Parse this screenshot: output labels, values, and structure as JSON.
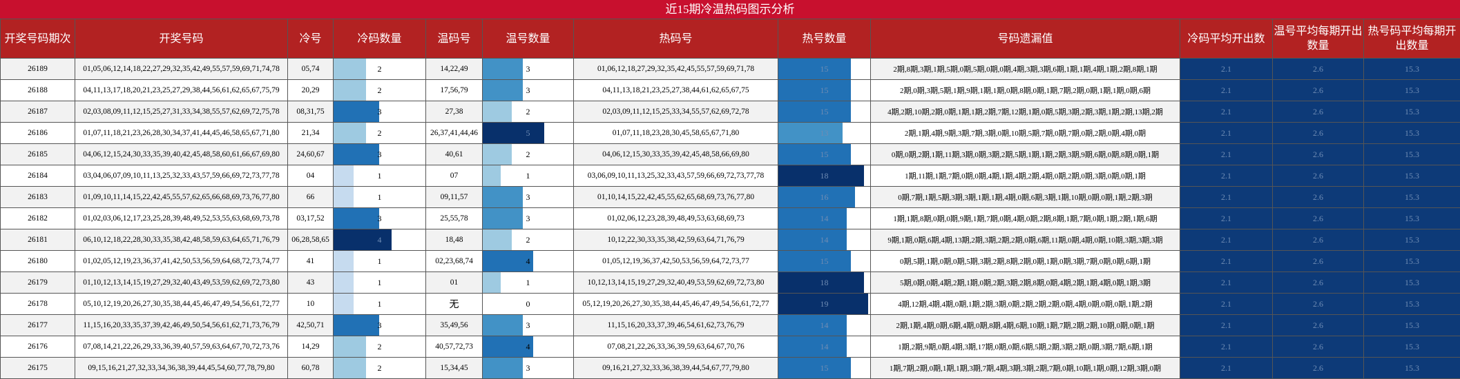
{
  "title": "近15期冷温热码图示分析",
  "headers": [
    "开奖号码期次",
    "开奖号码",
    "冷号",
    "冷码数量",
    "温码号",
    "温号数量",
    "热码号",
    "热号数量",
    "号码遗漏值",
    "冷码平均开出数",
    "温号平均每期开出数量",
    "热号码平均每期开出数量"
  ],
  "chart_data": {
    "type": "table",
    "title": "近15期冷温热码图示分析",
    "bar_max": {
      "cold": 4,
      "warm": 5,
      "hot": 19
    },
    "colors": {
      "header": "#b22222",
      "title": "#c8102e",
      "summary": "#0d3a78",
      "bar_light": "#c6dbef",
      "bar_mid": "#9ecae1",
      "bar_blue": "#4292c6",
      "bar_deep": "#2171b5",
      "bar_dark": "#08306b"
    },
    "rows": [
      {
        "issue": "26189",
        "numbers": "01,05,06,12,14,18,22,27,29,32,35,42,49,55,57,59,69,71,74,78",
        "cold": "05,74",
        "cold_count": 2,
        "warm": "14,22,49",
        "warm_count": 3,
        "hot": "01,06,12,18,27,29,32,35,42,45,55,57,59,69,71,78",
        "hot_count": 15,
        "miss": "2期,8期,3期,1期,5期,0期,5期,0期,0期,4期,3期,3期,6期,1期,1期,4期,1期,2期,8期,1期",
        "cold_avg": "2.1",
        "warm_avg": "2.6",
        "hot_avg": "15.3"
      },
      {
        "issue": "26188",
        "numbers": "04,11,13,17,18,20,21,23,25,27,29,38,44,56,61,62,65,67,75,79",
        "cold": "20,29",
        "cold_count": 2,
        "warm": "17,56,79",
        "warm_count": 3,
        "hot": "04,11,13,18,21,23,25,27,38,44,61,62,65,67,75",
        "hot_count": 15,
        "miss": "2期,0期,3期,5期,1期,9期,1期,1期,0期,8期,0期,1期,7期,2期,0期,1期,1期,0期,6期",
        "cold_avg": "2.1",
        "warm_avg": "2.6",
        "hot_avg": "15.3"
      },
      {
        "issue": "26187",
        "numbers": "02,03,08,09,11,12,15,25,27,31,33,34,38,55,57,62,69,72,75,78",
        "cold": "08,31,75",
        "cold_count": 3,
        "warm": "27,38",
        "warm_count": 2,
        "hot": "02,03,09,11,12,15,25,33,34,55,57,62,69,72,78",
        "hot_count": 15,
        "miss": "4期,2期,10期,2期,0期,1期,1期,2期,7期,12期,1期,0期,5期,3期,2期,3期,1期,2期,13期,2期",
        "cold_avg": "2.1",
        "warm_avg": "2.6",
        "hot_avg": "15.3"
      },
      {
        "issue": "26186",
        "numbers": "01,07,11,18,21,23,26,28,30,34,37,41,44,45,46,58,65,67,71,80",
        "cold": "21,34",
        "cold_count": 2,
        "warm": "26,37,41,44,46",
        "warm_count": 5,
        "hot": "01,07,11,18,23,28,30,45,58,65,67,71,80",
        "hot_count": 13,
        "miss": "2期,1期,4期,9期,3期,7期,3期,0期,10期,5期,7期,0期,7期,0期,2期,0期,4期,0期",
        "cold_avg": "2.1",
        "warm_avg": "2.6",
        "hot_avg": "15.3"
      },
      {
        "issue": "26185",
        "numbers": "04,06,12,15,24,30,33,35,39,40,42,45,48,58,60,61,66,67,69,80",
        "cold": "24,60,67",
        "cold_count": 3,
        "warm": "40,61",
        "warm_count": 2,
        "hot": "04,06,12,15,30,33,35,39,42,45,48,58,66,69,80",
        "hot_count": 15,
        "miss": "0期,0期,2期,1期,11期,3期,0期,3期,2期,5期,1期,1期,2期,3期,9期,6期,0期,8期,0期,1期",
        "cold_avg": "2.1",
        "warm_avg": "2.6",
        "hot_avg": "15.3"
      },
      {
        "issue": "26184",
        "numbers": "03,04,06,07,09,10,11,13,25,32,33,43,57,59,66,69,72,73,77,78",
        "cold": "04",
        "cold_count": 1,
        "warm": "07",
        "warm_count": 1,
        "hot": "03,06,09,10,11,13,25,32,33,43,57,59,66,69,72,73,77,78",
        "hot_count": 18,
        "miss": "1期,11期,1期,7期,0期,0期,4期,1期,4期,2期,4期,0期,2期,0期,3期,0期,0期,1期",
        "cold_avg": "2.1",
        "warm_avg": "2.6",
        "hot_avg": "15.3"
      },
      {
        "issue": "26183",
        "numbers": "01,09,10,11,14,15,22,42,45,55,57,62,65,66,68,69,73,76,77,80",
        "cold": "66",
        "cold_count": 1,
        "warm": "09,11,57",
        "warm_count": 3,
        "hot": "01,10,14,15,22,42,45,55,62,65,68,69,73,76,77,80",
        "hot_count": 16,
        "miss": "0期,7期,1期,5期,3期,3期,1期,1期,4期,0期,6期,3期,1期,10期,0期,0期,1期,2期,3期",
        "cold_avg": "2.1",
        "warm_avg": "2.6",
        "hot_avg": "15.3"
      },
      {
        "issue": "26182",
        "numbers": "01,02,03,06,12,17,23,25,28,39,48,49,52,53,55,63,68,69,73,78",
        "cold": "03,17,52",
        "cold_count": 3,
        "warm": "25,55,78",
        "warm_count": 3,
        "hot": "01,02,06,12,23,28,39,48,49,53,63,68,69,73",
        "hot_count": 14,
        "miss": "1期,1期,8期,0期,0期,9期,1期,7期,0期,4期,0期,2期,8期,1期,7期,0期,1期,2期,1期,6期",
        "cold_avg": "2.1",
        "warm_avg": "2.6",
        "hot_avg": "15.3"
      },
      {
        "issue": "26181",
        "numbers": "06,10,12,18,22,28,30,33,35,38,42,48,58,59,63,64,65,71,76,79",
        "cold": "06,28,58,65",
        "cold_count": 4,
        "warm": "18,48",
        "warm_count": 2,
        "hot": "10,12,22,30,33,35,38,42,59,63,64,71,76,79",
        "hot_count": 14,
        "miss": "9期,1期,0期,6期,4期,13期,2期,3期,2期,2期,0期,6期,11期,0期,4期,0期,10期,3期,3期,3期",
        "cold_avg": "2.1",
        "warm_avg": "2.6",
        "hot_avg": "15.3"
      },
      {
        "issue": "26180",
        "numbers": "01,02,05,12,19,23,36,37,41,42,50,53,56,59,64,68,72,73,74,77",
        "cold": "41",
        "cold_count": 1,
        "warm": "02,23,68,74",
        "warm_count": 4,
        "hot": "01,05,12,19,36,37,42,50,53,56,59,64,72,73,77",
        "hot_count": 15,
        "miss": "0期,5期,1期,0期,0期,5期,3期,2期,8期,2期,0期,1期,0期,3期,7期,0期,0期,6期,1期",
        "cold_avg": "2.1",
        "warm_avg": "2.6",
        "hot_avg": "15.3"
      },
      {
        "issue": "26179",
        "numbers": "01,10,12,13,14,15,19,27,29,32,40,43,49,53,59,62,69,72,73,80",
        "cold": "43",
        "cold_count": 1,
        "warm": "01",
        "warm_count": 1,
        "hot": "10,12,13,14,15,19,27,29,32,40,49,53,59,62,69,72,73,80",
        "hot_count": 18,
        "miss": "5期,0期,0期,4期,2期,1期,0期,2期,3期,2期,8期,0期,4期,2期,1期,4期,0期,1期,3期",
        "cold_avg": "2.1",
        "warm_avg": "2.6",
        "hot_avg": "15.3"
      },
      {
        "issue": "26178",
        "numbers": "05,10,12,19,20,26,27,30,35,38,44,45,46,47,49,54,56,61,72,77",
        "cold": "10",
        "cold_count": 1,
        "warm": "无",
        "warm_count": 0,
        "hot": "05,12,19,20,26,27,30,35,38,44,45,46,47,49,54,56,61,72,77",
        "hot_count": 19,
        "miss": "4期,12期,4期,4期,0期,1期,2期,3期,0期,2期,2期,2期,0期,4期,0期,0期,0期,1期,2期",
        "cold_avg": "2.1",
        "warm_avg": "2.6",
        "hot_avg": "15.3"
      },
      {
        "issue": "26177",
        "numbers": "11,15,16,20,33,35,37,39,42,46,49,50,54,56,61,62,71,73,76,79",
        "cold": "42,50,71",
        "cold_count": 3,
        "warm": "35,49,56",
        "warm_count": 3,
        "hot": "11,15,16,20,33,37,39,46,54,61,62,73,76,79",
        "hot_count": 14,
        "miss": "2期,1期,4期,0期,6期,4期,0期,8期,4期,6期,10期,1期,7期,2期,2期,10期,0期,0期,1期",
        "cold_avg": "2.1",
        "warm_avg": "2.6",
        "hot_avg": "15.3"
      },
      {
        "issue": "26176",
        "numbers": "07,08,14,21,22,26,29,33,36,39,40,57,59,63,64,67,70,72,73,76",
        "cold": "14,29",
        "cold_count": 2,
        "warm": "40,57,72,73",
        "warm_count": 4,
        "hot": "07,08,21,22,26,33,36,39,59,63,64,67,70,76",
        "hot_count": 14,
        "miss": "1期,2期,9期,0期,4期,3期,17期,0期,0期,6期,5期,2期,3期,2期,0期,3期,7期,6期,1期",
        "cold_avg": "2.1",
        "warm_avg": "2.6",
        "hot_avg": "15.3"
      },
      {
        "issue": "26175",
        "numbers": "09,15,16,21,27,32,33,34,36,38,39,44,45,54,60,77,78,79,80",
        "cold": "60,78",
        "cold_count": 2,
        "warm": "15,34,45",
        "warm_count": 3,
        "hot": "09,16,21,27,32,33,36,38,39,44,54,67,77,79,80",
        "hot_count": 15,
        "miss": "1期,7期,2期,0期,1期,1期,3期,7期,4期,3期,3期,2期,7期,0期,10期,1期,0期,12期,3期,0期",
        "cold_avg": "2.1",
        "warm_avg": "2.6",
        "hot_avg": "15.3"
      }
    ]
  }
}
